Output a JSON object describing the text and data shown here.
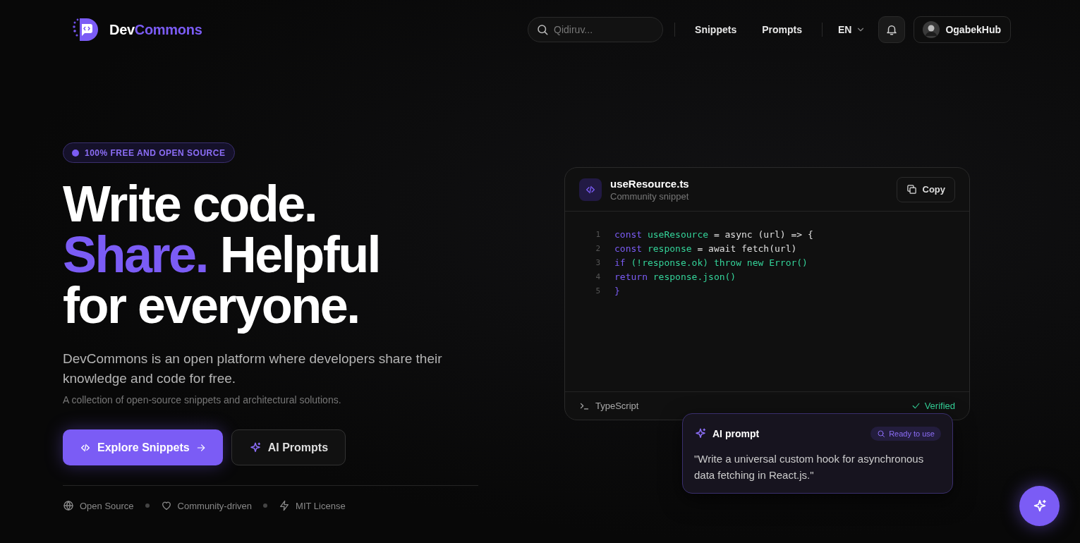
{
  "header": {
    "brand": [
      {
        "text": "Dev",
        "kind": "plain"
      },
      {
        "text": "Commons",
        "kind": "accent"
      }
    ],
    "search": {
      "placeholder": "Qidiruv..."
    },
    "nav": [
      {
        "label": "Snippets"
      },
      {
        "label": "Prompts"
      }
    ],
    "language": {
      "label": "EN"
    },
    "user": {
      "name": "OgabekHub"
    }
  },
  "hero": {
    "badge": "100% FREE AND OPEN SOURCE",
    "headline": [
      [
        {
          "text": "Write code.",
          "kind": "plain"
        }
      ],
      [
        {
          "text": "Share.",
          "kind": "accent"
        },
        {
          "text": " Helpful",
          "kind": "plain"
        }
      ],
      [
        {
          "text": "for everyone.",
          "kind": "plain"
        }
      ]
    ],
    "description": "DevCommons is an open platform where developers share their knowledge and code for free.",
    "subtext": "A collection of open-source snippets and architectural solutions.",
    "buttons": [
      {
        "label": "Explore Snippets",
        "kind": "primary"
      },
      {
        "label": "AI Prompts",
        "kind": "secondary"
      }
    ],
    "features": [
      {
        "label": "Open Source",
        "kind": "globe"
      },
      {
        "label": "Community-driven",
        "kind": "heart"
      },
      {
        "label": "MIT License",
        "kind": "bolt"
      }
    ]
  },
  "snippet": {
    "filename": "useResource.ts",
    "subtitle": "Community snippet",
    "copy": "Copy",
    "lines": [
      {
        "number": "1",
        "tokens": [
          {
            "text": "const",
            "kind": "keyword"
          },
          {
            "text": " useResource",
            "kind": "name"
          },
          {
            "text": " = async (url) => {",
            "kind": "plain"
          }
        ]
      },
      {
        "number": "2",
        "tokens": [
          {
            "text": "const",
            "kind": "keyword"
          },
          {
            "text": " response",
            "kind": "name"
          },
          {
            "text": " = await fetch(url)",
            "kind": "plain"
          }
        ]
      },
      {
        "number": "3",
        "tokens": [
          {
            "text": "if",
            "kind": "keyword"
          },
          {
            "text": " (!response.ok) throw new Error()",
            "kind": "name"
          }
        ]
      },
      {
        "number": "4",
        "tokens": [
          {
            "text": "return",
            "kind": "keyword"
          },
          {
            "text": " response.json()",
            "kind": "name"
          }
        ]
      },
      {
        "number": "5",
        "tokens": [
          {
            "text": "}",
            "kind": "keyword"
          }
        ]
      }
    ],
    "language": "TypeScript",
    "status": "Verified"
  },
  "prompt_card": {
    "title": "AI prompt",
    "badge": "Ready to use",
    "text": "\"Write a universal custom hook for asynchronous data fetching in React.js.\""
  }
}
